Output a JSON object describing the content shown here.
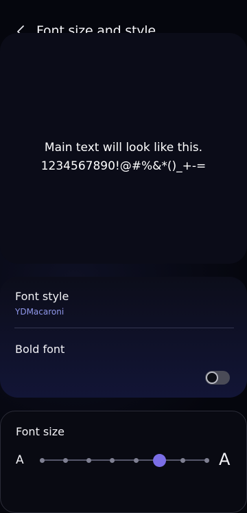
{
  "header": {
    "title": "Font size and style",
    "back_icon": "chevron-left-icon"
  },
  "preview": {
    "line1": "Main text will look like this.",
    "line2": "1234567890!@#%&*()_+-="
  },
  "font_style": {
    "label": "Font style",
    "value": "YDMacaroni"
  },
  "bold_font": {
    "label": "Bold font",
    "enabled": false
  },
  "font_size": {
    "label": "Font size",
    "small_glyph": "A",
    "large_glyph": "A",
    "steps": 8,
    "selected_step": 5
  },
  "colors": {
    "accent": "#7b6ee6",
    "subtext": "#8f97ea",
    "background": "#05060d"
  }
}
